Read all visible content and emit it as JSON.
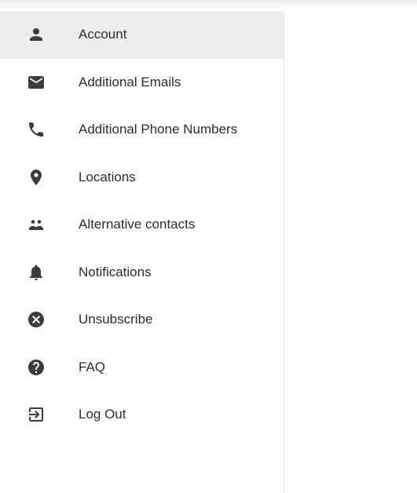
{
  "nav": {
    "items": [
      {
        "label": "Account",
        "icon": "person-icon",
        "active": true
      },
      {
        "label": "Additional Emails",
        "icon": "mail-icon"
      },
      {
        "label": "Additional Phone Numbers",
        "icon": "phone-icon"
      },
      {
        "label": "Locations",
        "icon": "location-pin-icon"
      },
      {
        "label": "Alternative contacts",
        "icon": "people-icon"
      },
      {
        "label": "Notifications",
        "icon": "bell-icon"
      },
      {
        "label": "Unsubscribe",
        "icon": "cancel-circle-icon"
      },
      {
        "label": "FAQ",
        "icon": "help-circle-icon"
      },
      {
        "label": "Log Out",
        "icon": "logout-icon"
      }
    ]
  },
  "colors": {
    "active_background": "#ededee",
    "icon": "#3c3c3c",
    "text": "#2c2c2c",
    "divider": "#e0e0e0"
  }
}
